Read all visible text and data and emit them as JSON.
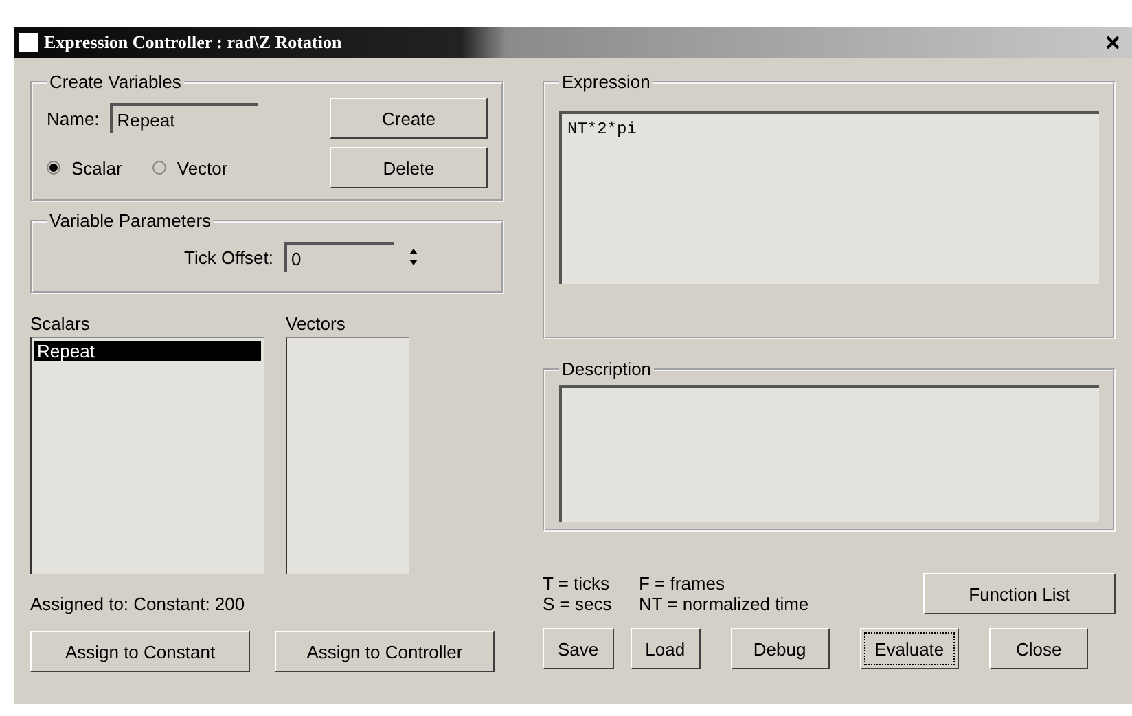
{
  "window": {
    "title": "Expression Controller : rad\\Z Rotation"
  },
  "create_variables": {
    "title": "Create Variables",
    "name_label": "Name:",
    "name_value": "Repeat",
    "buttons": [
      "Create",
      "Delete"
    ],
    "types": [
      {
        "label": "Scalar",
        "selected": true
      },
      {
        "label": "Vector",
        "selected": false
      }
    ]
  },
  "variable_parameters": {
    "title": "Variable Parameters",
    "tick_offset_label": "Tick Offset:",
    "tick_offset_value": "0"
  },
  "scalars": {
    "title": "Scalars",
    "items": [
      {
        "label": "Repeat",
        "selected": true
      }
    ]
  },
  "vectors": {
    "title": "Vectors"
  },
  "assigned_to": "Assigned to:  Constant: 200",
  "assign_buttons": [
    "Assign to Constant",
    "Assign to Controller"
  ],
  "expression": {
    "title": "Expression",
    "value": "NT*2*pi"
  },
  "description": {
    "title": "Description"
  },
  "legend": [
    "T = ticks",
    "F = frames",
    "S = secs",
    "NT = normalized time"
  ],
  "function_list_button": "Function List",
  "buttons": [
    {
      "label": "Save",
      "focused": false
    },
    {
      "label": "Load",
      "focused": false
    },
    {
      "label": "Debug",
      "focused": false
    },
    {
      "label": "Evaluate",
      "focused": true
    },
    {
      "label": "Close",
      "focused": false
    }
  ]
}
